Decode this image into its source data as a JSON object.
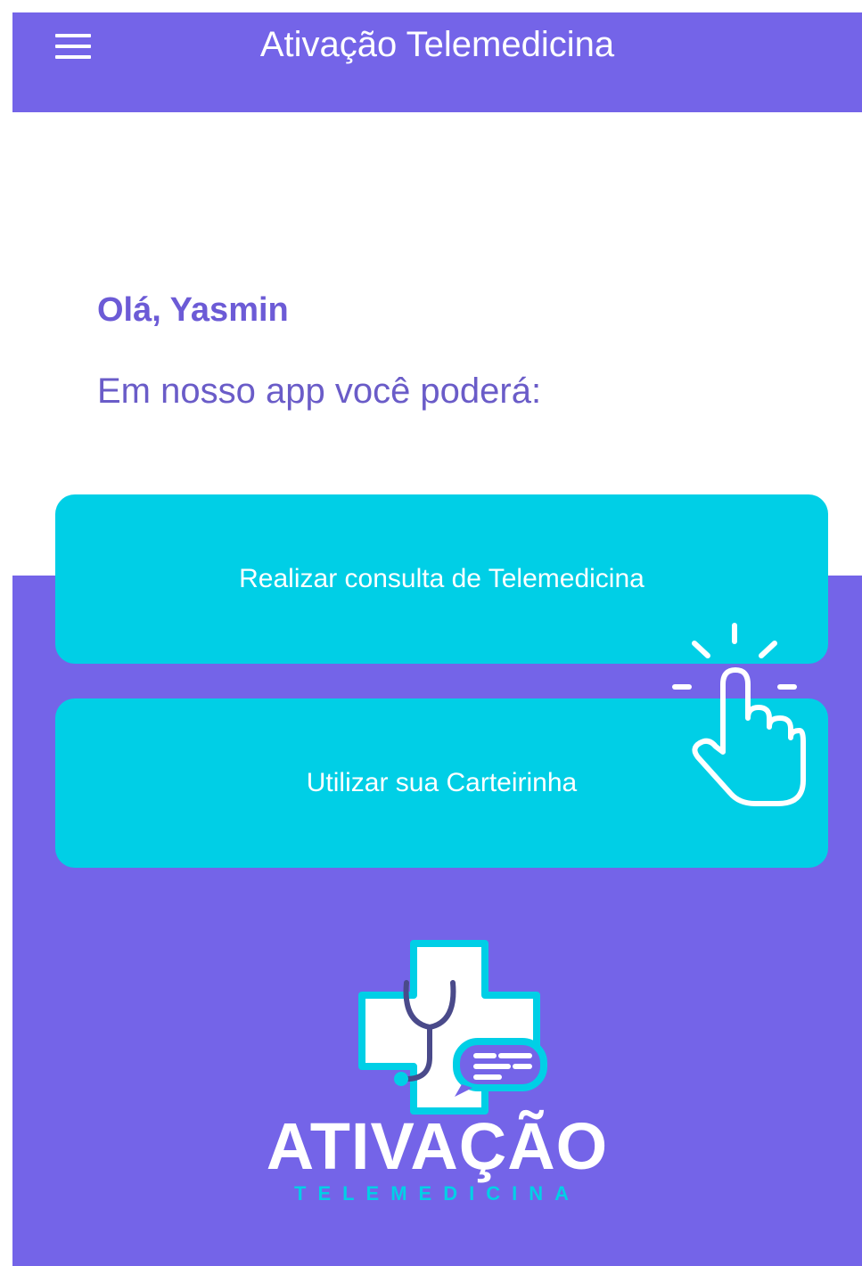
{
  "app_bar": {
    "title": "Ativação Telemedicina",
    "menu_icon": "hamburger-menu-icon",
    "background": "#7464e8"
  },
  "main": {
    "greeting": "Olá, Yasmin",
    "intro": "Em nosso app você poderá:"
  },
  "actions": [
    {
      "label": "Realizar consulta de Telemedicina"
    },
    {
      "label": "Utilizar sua Carteirinha"
    }
  ],
  "colors": {
    "primary": "#7464e8",
    "accent": "#00cfe6",
    "greeting_text": "#6c5bd6"
  },
  "overlay": {
    "icon": "tap-hand-icon"
  },
  "logo": {
    "icon": "medical-cross-stethoscope-icon",
    "word": "ATIVAÇÃO",
    "sub": "TELEMEDICINA"
  }
}
